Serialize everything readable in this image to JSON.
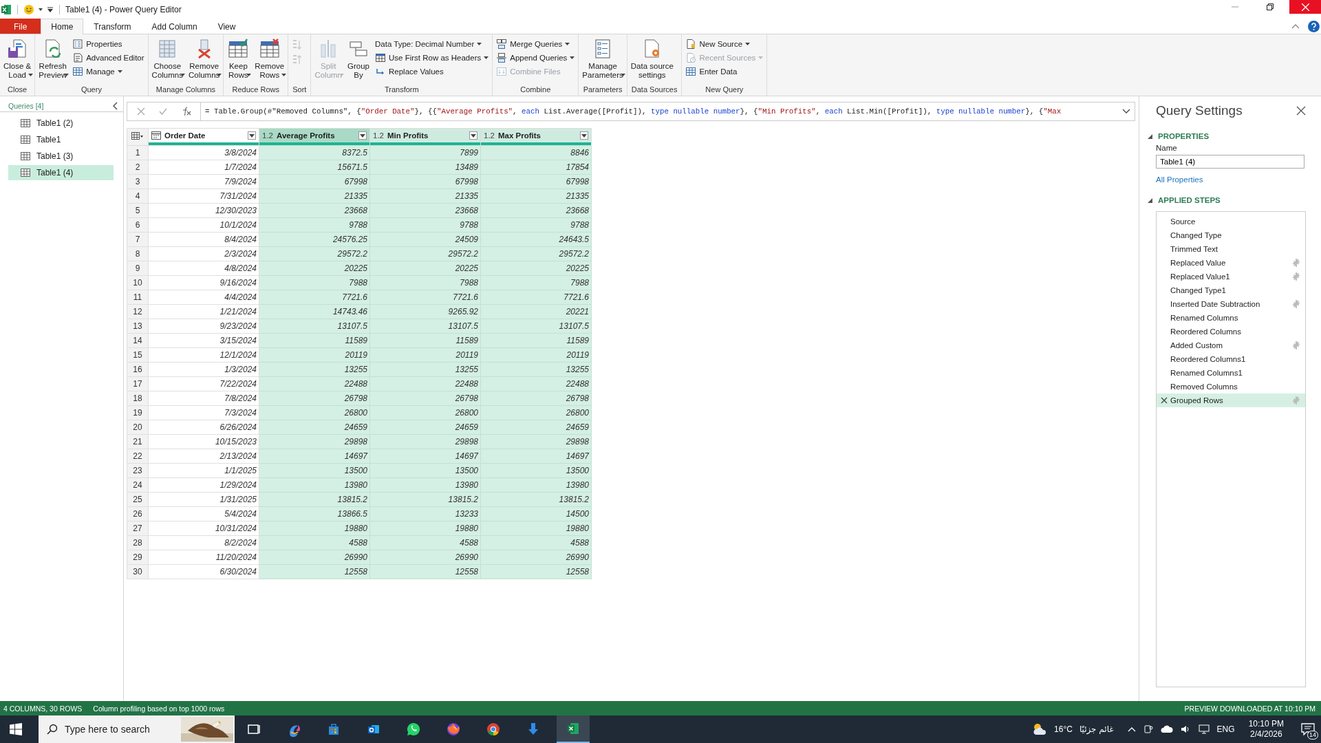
{
  "window": {
    "title": "Table1 (4) - Power Query Editor"
  },
  "ribbon_tabs": [
    {
      "label": "File",
      "kind": "file",
      "selected": false
    },
    {
      "label": "Home",
      "kind": "tab",
      "selected": true
    },
    {
      "label": "Transform",
      "kind": "tab",
      "selected": false
    },
    {
      "label": "Add Column",
      "kind": "tab",
      "selected": false
    },
    {
      "label": "View",
      "kind": "tab",
      "selected": false
    }
  ],
  "ribbon": {
    "groups": [
      {
        "label": "Close",
        "columns": [
          {
            "kind": "large",
            "lines": [
              "Close &",
              "Load"
            ],
            "dropdown": true,
            "disabled": false
          }
        ]
      },
      {
        "label": "Query",
        "columns": [
          {
            "kind": "large",
            "lines": [
              "Refresh",
              "Preview"
            ],
            "dropdown": true,
            "disabled": false
          },
          {
            "kind": "stack",
            "buttons": [
              {
                "label": "Properties",
                "dropdown": false,
                "disabled": false
              },
              {
                "label": "Advanced Editor",
                "dropdown": false,
                "disabled": false
              },
              {
                "label": "Manage",
                "dropdown": true,
                "disabled": false
              }
            ]
          }
        ]
      },
      {
        "label": "Manage Columns",
        "columns": [
          {
            "kind": "large",
            "lines": [
              "Choose",
              "Columns"
            ],
            "dropdown": true,
            "disabled": false
          },
          {
            "kind": "large",
            "lines": [
              "Remove",
              "Columns"
            ],
            "dropdown": true,
            "disabled": false
          }
        ]
      },
      {
        "label": "Reduce Rows",
        "columns": [
          {
            "kind": "large",
            "lines": [
              "Keep",
              "Rows"
            ],
            "dropdown": true,
            "disabled": false
          },
          {
            "kind": "large",
            "lines": [
              "Remove",
              "Rows"
            ],
            "dropdown": true,
            "disabled": false
          }
        ]
      },
      {
        "label": "Sort",
        "columns": [
          {
            "kind": "icons",
            "buttons": [
              {
                "disabled": true
              },
              {
                "disabled": true
              }
            ]
          }
        ]
      },
      {
        "label": "Transform",
        "columns": [
          {
            "kind": "large",
            "lines": [
              "Split",
              "Column"
            ],
            "dropdown": true,
            "disabled": true
          },
          {
            "kind": "large",
            "lines": [
              "Group",
              "By"
            ],
            "dropdown": false,
            "disabled": false
          },
          {
            "kind": "stack",
            "buttons": [
              {
                "label": "Data Type: Decimal Number",
                "dropdown": true,
                "disabled": false
              },
              {
                "label": "Use First Row as Headers",
                "dropdown": true,
                "disabled": false
              },
              {
                "label": "Replace Values",
                "dropdown": false,
                "disabled": false
              }
            ]
          }
        ]
      },
      {
        "label": "Combine",
        "columns": [
          {
            "kind": "stack",
            "buttons": [
              {
                "label": "Merge Queries",
                "dropdown": true,
                "disabled": false
              },
              {
                "label": "Append Queries",
                "dropdown": true,
                "disabled": false
              },
              {
                "label": "Combine Files",
                "dropdown": false,
                "disabled": true
              }
            ]
          }
        ]
      },
      {
        "label": "Parameters",
        "columns": [
          {
            "kind": "large",
            "lines": [
              "Manage",
              "Parameters"
            ],
            "dropdown": true,
            "disabled": false
          }
        ]
      },
      {
        "label": "Data Sources",
        "columns": [
          {
            "kind": "large",
            "lines": [
              "Data source",
              "settings"
            ],
            "dropdown": false,
            "disabled": false
          }
        ]
      },
      {
        "label": "New Query",
        "columns": [
          {
            "kind": "stack",
            "buttons": [
              {
                "label": "New Source",
                "dropdown": true,
                "disabled": false
              },
              {
                "label": "Recent Sources",
                "dropdown": true,
                "disabled": true
              },
              {
                "label": "Enter Data",
                "dropdown": false,
                "disabled": false
              }
            ]
          }
        ]
      }
    ]
  },
  "queries": {
    "title": "Queries [4]",
    "items": [
      {
        "label": "Table1 (2)",
        "selected": false
      },
      {
        "label": "Table1",
        "selected": false
      },
      {
        "label": "Table1 (3)",
        "selected": false
      },
      {
        "label": "Table1 (4)",
        "selected": true
      }
    ]
  },
  "formula": [
    {
      "t": "= Table.Group(#\"Removed Columns\", {",
      "kind": "plain"
    },
    {
      "t": "\"Order Date\"",
      "kind": "string"
    },
    {
      "t": "}, {{",
      "kind": "plain"
    },
    {
      "t": "\"Average Profits\"",
      "kind": "string"
    },
    {
      "t": ", ",
      "kind": "plain"
    },
    {
      "t": "each",
      "kind": "keyword"
    },
    {
      "t": " List.Average([Profit]), ",
      "kind": "plain"
    },
    {
      "t": "type nullable number",
      "kind": "keyword"
    },
    {
      "t": "}, {",
      "kind": "plain"
    },
    {
      "t": "\"Min Profits\"",
      "kind": "string"
    },
    {
      "t": ", ",
      "kind": "plain"
    },
    {
      "t": "each",
      "kind": "keyword"
    },
    {
      "t": " List.Min([Profit]), ",
      "kind": "plain"
    },
    {
      "t": "type nullable number",
      "kind": "keyword"
    },
    {
      "t": "}, {",
      "kind": "plain"
    },
    {
      "t": "\"Max",
      "kind": "string"
    }
  ],
  "table": {
    "columns": [
      {
        "name": "Order Date",
        "kind": "date",
        "selected": false,
        "focused": false
      },
      {
        "name": "Average Profits",
        "kind": "number",
        "type_label": "1.2",
        "selected": true,
        "focused": true
      },
      {
        "name": "Min Profits",
        "kind": "number",
        "type_label": "1.2",
        "selected": true,
        "focused": false
      },
      {
        "name": "Max Profits",
        "kind": "number",
        "type_label": "1.2",
        "selected": true,
        "focused": false
      }
    ],
    "rows": [
      {
        "n": "1",
        "cells": [
          "3/8/2024",
          "8372.5",
          "7899",
          "8846"
        ]
      },
      {
        "n": "2",
        "cells": [
          "1/7/2024",
          "15671.5",
          "13489",
          "17854"
        ]
      },
      {
        "n": "3",
        "cells": [
          "7/9/2024",
          "67998",
          "67998",
          "67998"
        ]
      },
      {
        "n": "4",
        "cells": [
          "7/31/2024",
          "21335",
          "21335",
          "21335"
        ]
      },
      {
        "n": "5",
        "cells": [
          "12/30/2023",
          "23668",
          "23668",
          "23668"
        ]
      },
      {
        "n": "6",
        "cells": [
          "10/1/2024",
          "9788",
          "9788",
          "9788"
        ]
      },
      {
        "n": "7",
        "cells": [
          "8/4/2024",
          "24576.25",
          "24509",
          "24643.5"
        ]
      },
      {
        "n": "8",
        "cells": [
          "2/3/2024",
          "29572.2",
          "29572.2",
          "29572.2"
        ]
      },
      {
        "n": "9",
        "cells": [
          "4/8/2024",
          "20225",
          "20225",
          "20225"
        ]
      },
      {
        "n": "10",
        "cells": [
          "9/16/2024",
          "7988",
          "7988",
          "7988"
        ]
      },
      {
        "n": "11",
        "cells": [
          "4/4/2024",
          "7721.6",
          "7721.6",
          "7721.6"
        ]
      },
      {
        "n": "12",
        "cells": [
          "1/21/2024",
          "14743.46",
          "9265.92",
          "20221"
        ]
      },
      {
        "n": "13",
        "cells": [
          "9/23/2024",
          "13107.5",
          "13107.5",
          "13107.5"
        ]
      },
      {
        "n": "14",
        "cells": [
          "3/15/2024",
          "11589",
          "11589",
          "11589"
        ]
      },
      {
        "n": "15",
        "cells": [
          "12/1/2024",
          "20119",
          "20119",
          "20119"
        ]
      },
      {
        "n": "16",
        "cells": [
          "1/3/2024",
          "13255",
          "13255",
          "13255"
        ]
      },
      {
        "n": "17",
        "cells": [
          "7/22/2024",
          "22488",
          "22488",
          "22488"
        ]
      },
      {
        "n": "18",
        "cells": [
          "7/8/2024",
          "26798",
          "26798",
          "26798"
        ]
      },
      {
        "n": "19",
        "cells": [
          "7/3/2024",
          "26800",
          "26800",
          "26800"
        ]
      },
      {
        "n": "20",
        "cells": [
          "6/26/2024",
          "24659",
          "24659",
          "24659"
        ]
      },
      {
        "n": "21",
        "cells": [
          "10/15/2023",
          "29898",
          "29898",
          "29898"
        ]
      },
      {
        "n": "22",
        "cells": [
          "2/13/2024",
          "14697",
          "14697",
          "14697"
        ]
      },
      {
        "n": "23",
        "cells": [
          "1/1/2025",
          "13500",
          "13500",
          "13500"
        ]
      },
      {
        "n": "24",
        "cells": [
          "1/29/2024",
          "13980",
          "13980",
          "13980"
        ]
      },
      {
        "n": "25",
        "cells": [
          "1/31/2025",
          "13815.2",
          "13815.2",
          "13815.2"
        ]
      },
      {
        "n": "26",
        "cells": [
          "5/4/2024",
          "13866.5",
          "13233",
          "14500"
        ]
      },
      {
        "n": "27",
        "cells": [
          "10/31/2024",
          "19880",
          "19880",
          "19880"
        ]
      },
      {
        "n": "28",
        "cells": [
          "8/2/2024",
          "4588",
          "4588",
          "4588"
        ]
      },
      {
        "n": "29",
        "cells": [
          "11/20/2024",
          "26990",
          "26990",
          "26990"
        ]
      },
      {
        "n": "30",
        "cells": [
          "6/30/2024",
          "12558",
          "12558",
          "12558"
        ]
      }
    ]
  },
  "query_settings": {
    "title": "Query Settings",
    "properties_heading": "PROPERTIES",
    "name_label": "Name",
    "name_value": "Table1 (4)",
    "all_properties_link": "All Properties",
    "steps_heading": "APPLIED STEPS",
    "steps": [
      {
        "label": "Source",
        "has_settings": false,
        "selected": false
      },
      {
        "label": "Changed Type",
        "has_settings": false,
        "selected": false
      },
      {
        "label": "Trimmed Text",
        "has_settings": false,
        "selected": false
      },
      {
        "label": "Replaced Value",
        "has_settings": true,
        "selected": false
      },
      {
        "label": "Replaced Value1",
        "has_settings": true,
        "selected": false
      },
      {
        "label": "Changed Type1",
        "has_settings": false,
        "selected": false
      },
      {
        "label": "Inserted Date Subtraction",
        "has_settings": true,
        "selected": false
      },
      {
        "label": "Renamed Columns",
        "has_settings": false,
        "selected": false
      },
      {
        "label": "Reordered Columns",
        "has_settings": false,
        "selected": false
      },
      {
        "label": "Added Custom",
        "has_settings": true,
        "selected": false
      },
      {
        "label": "Reordered Columns1",
        "has_settings": false,
        "selected": false
      },
      {
        "label": "Renamed Columns1",
        "has_settings": false,
        "selected": false
      },
      {
        "label": "Removed Columns",
        "has_settings": false,
        "selected": false
      },
      {
        "label": "Grouped Rows",
        "has_settings": true,
        "selected": true
      }
    ]
  },
  "status_bar": {
    "left": [
      "4 COLUMNS, 30 ROWS",
      "Column profiling based on top 1000 rows"
    ],
    "right": "PREVIEW DOWNLOADED AT 10:10 PM"
  },
  "taskbar": {
    "search_placeholder": "Type here to search",
    "apps": [
      {
        "active": false
      },
      {
        "active": false
      },
      {
        "active": false
      },
      {
        "active": false
      },
      {
        "active": false
      },
      {
        "active": false
      },
      {
        "active": false
      },
      {
        "active": false
      },
      {
        "active": true
      }
    ],
    "temperature": "16°C",
    "weather": "غائم جزئيًا",
    "language": "ENG",
    "time": "10:10 PM",
    "date": "2/4/2026",
    "notifications": "14"
  }
}
